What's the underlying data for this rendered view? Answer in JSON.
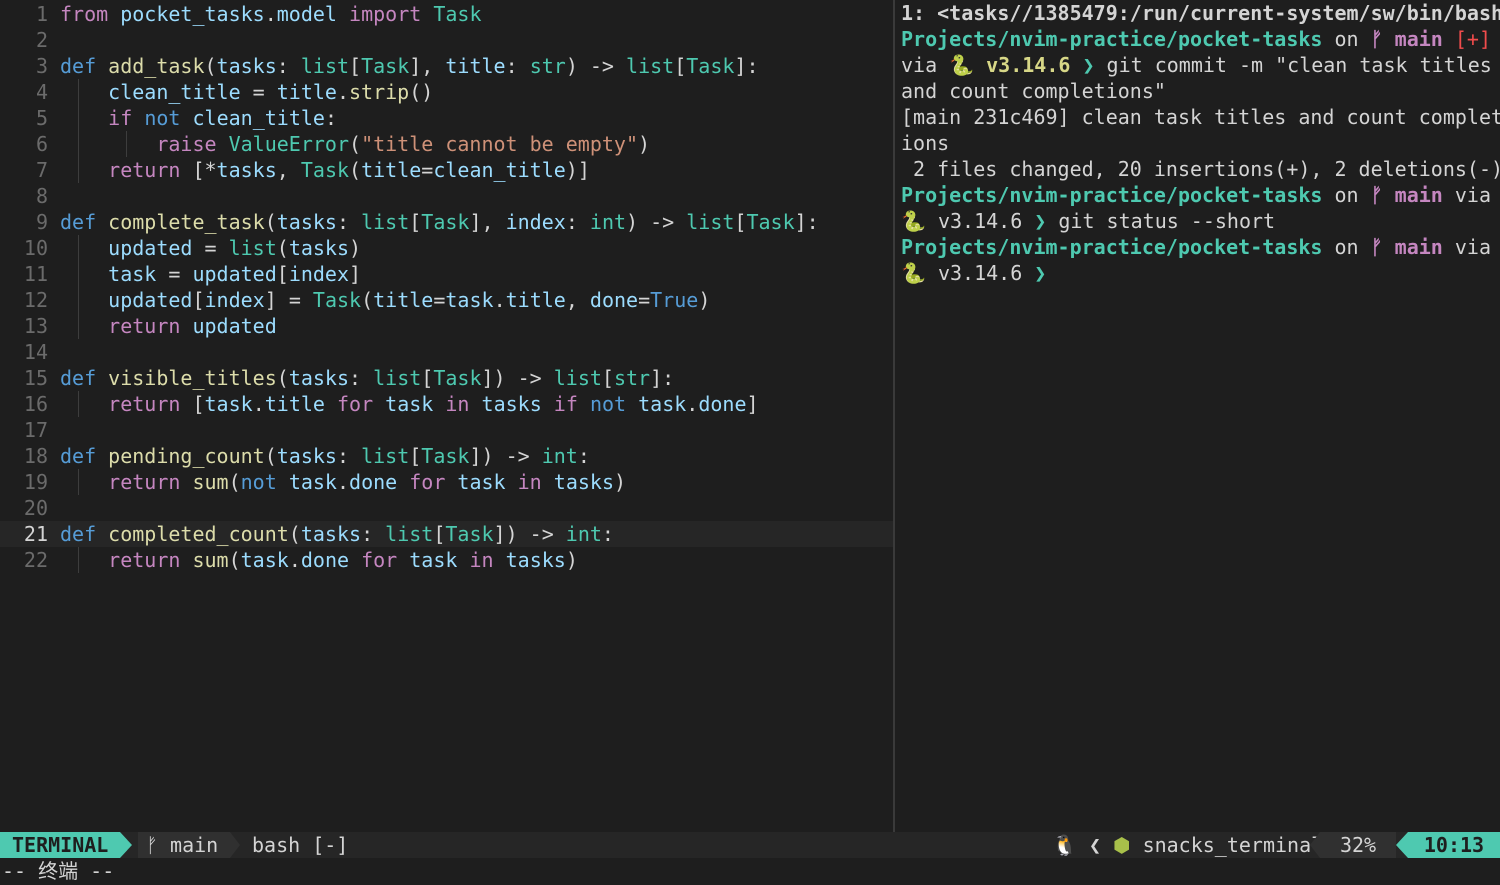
{
  "editor": {
    "lines": [
      {
        "n": "1",
        "tokens": [
          [
            "kw2",
            "from"
          ],
          [
            "pu",
            " "
          ],
          [
            "va",
            "pocket_tasks"
          ],
          [
            "pu",
            "."
          ],
          [
            "va",
            "model"
          ],
          [
            "pu",
            " "
          ],
          [
            "kw2",
            "import"
          ],
          [
            "pu",
            " "
          ],
          [
            "ty",
            "Task"
          ]
        ]
      },
      {
        "n": "2",
        "tokens": []
      },
      {
        "n": "3",
        "tokens": [
          [
            "kw",
            "def"
          ],
          [
            "pu",
            " "
          ],
          [
            "fn",
            "add_task"
          ],
          [
            "pu",
            "("
          ],
          [
            "va",
            "tasks"
          ],
          [
            "pu",
            ": "
          ],
          [
            "ty",
            "list"
          ],
          [
            "pu",
            "["
          ],
          [
            "ty",
            "Task"
          ],
          [
            "pu",
            "], "
          ],
          [
            "va",
            "title"
          ],
          [
            "pu",
            ": "
          ],
          [
            "ty",
            "str"
          ],
          [
            "pu",
            ") -> "
          ],
          [
            "ty",
            "list"
          ],
          [
            "pu",
            "["
          ],
          [
            "ty",
            "Task"
          ],
          [
            "pu",
            "]:"
          ]
        ]
      },
      {
        "n": "4",
        "tokens": [
          [
            "pu",
            "    "
          ],
          [
            "va",
            "clean_title"
          ],
          [
            "pu",
            " = "
          ],
          [
            "va",
            "title"
          ],
          [
            "pu",
            "."
          ],
          [
            "fn",
            "strip"
          ],
          [
            "pu",
            "()"
          ]
        ]
      },
      {
        "n": "5",
        "tokens": [
          [
            "pu",
            "    "
          ],
          [
            "kw2",
            "if"
          ],
          [
            "pu",
            " "
          ],
          [
            "kw",
            "not"
          ],
          [
            "pu",
            " "
          ],
          [
            "va",
            "clean_title"
          ],
          [
            "pu",
            ":"
          ]
        ]
      },
      {
        "n": "6",
        "tokens": [
          [
            "pu",
            "        "
          ],
          [
            "kw2",
            "raise"
          ],
          [
            "pu",
            " "
          ],
          [
            "ty",
            "ValueError"
          ],
          [
            "pu",
            "("
          ],
          [
            "st",
            "\"title cannot be empty\""
          ],
          [
            "pu",
            ")"
          ]
        ]
      },
      {
        "n": "7",
        "tokens": [
          [
            "pu",
            "    "
          ],
          [
            "kw2",
            "return"
          ],
          [
            "pu",
            " [*"
          ],
          [
            "va",
            "tasks"
          ],
          [
            "pu",
            ", "
          ],
          [
            "ty",
            "Task"
          ],
          [
            "pu",
            "("
          ],
          [
            "va",
            "title"
          ],
          [
            "pu",
            "="
          ],
          [
            "va",
            "clean_title"
          ],
          [
            "pu",
            ")]"
          ]
        ]
      },
      {
        "n": "8",
        "tokens": []
      },
      {
        "n": "9",
        "tokens": [
          [
            "kw",
            "def"
          ],
          [
            "pu",
            " "
          ],
          [
            "fn",
            "complete_task"
          ],
          [
            "pu",
            "("
          ],
          [
            "va",
            "tasks"
          ],
          [
            "pu",
            ": "
          ],
          [
            "ty",
            "list"
          ],
          [
            "pu",
            "["
          ],
          [
            "ty",
            "Task"
          ],
          [
            "pu",
            "], "
          ],
          [
            "va",
            "index"
          ],
          [
            "pu",
            ": "
          ],
          [
            "ty",
            "int"
          ],
          [
            "pu",
            ") -> "
          ],
          [
            "ty",
            "list"
          ],
          [
            "pu",
            "["
          ],
          [
            "ty",
            "Task"
          ],
          [
            "pu",
            "]:"
          ]
        ]
      },
      {
        "n": "10",
        "tokens": [
          [
            "pu",
            "    "
          ],
          [
            "va",
            "updated"
          ],
          [
            "pu",
            " = "
          ],
          [
            "ty",
            "list"
          ],
          [
            "pu",
            "("
          ],
          [
            "va",
            "tasks"
          ],
          [
            "pu",
            ")"
          ]
        ]
      },
      {
        "n": "11",
        "tokens": [
          [
            "pu",
            "    "
          ],
          [
            "va",
            "task"
          ],
          [
            "pu",
            " = "
          ],
          [
            "va",
            "updated"
          ],
          [
            "pu",
            "["
          ],
          [
            "va",
            "index"
          ],
          [
            "pu",
            "]"
          ]
        ]
      },
      {
        "n": "12",
        "tokens": [
          [
            "pu",
            "    "
          ],
          [
            "va",
            "updated"
          ],
          [
            "pu",
            "["
          ],
          [
            "va",
            "index"
          ],
          [
            "pu",
            "] = "
          ],
          [
            "ty",
            "Task"
          ],
          [
            "pu",
            "("
          ],
          [
            "va",
            "title"
          ],
          [
            "pu",
            "="
          ],
          [
            "va",
            "task"
          ],
          [
            "pu",
            "."
          ],
          [
            "va",
            "title"
          ],
          [
            "pu",
            ", "
          ],
          [
            "va",
            "done"
          ],
          [
            "pu",
            "="
          ],
          [
            "kw",
            "True"
          ],
          [
            "pu",
            ")"
          ]
        ]
      },
      {
        "n": "13",
        "tokens": [
          [
            "pu",
            "    "
          ],
          [
            "kw2",
            "return"
          ],
          [
            "pu",
            " "
          ],
          [
            "va",
            "updated"
          ]
        ]
      },
      {
        "n": "14",
        "tokens": []
      },
      {
        "n": "15",
        "tokens": [
          [
            "kw",
            "def"
          ],
          [
            "pu",
            " "
          ],
          [
            "fn",
            "visible_titles"
          ],
          [
            "pu",
            "("
          ],
          [
            "va",
            "tasks"
          ],
          [
            "pu",
            ": "
          ],
          [
            "ty",
            "list"
          ],
          [
            "pu",
            "["
          ],
          [
            "ty",
            "Task"
          ],
          [
            "pu",
            "]) -> "
          ],
          [
            "ty",
            "list"
          ],
          [
            "pu",
            "["
          ],
          [
            "ty",
            "str"
          ],
          [
            "pu",
            "]:"
          ]
        ]
      },
      {
        "n": "16",
        "tokens": [
          [
            "pu",
            "    "
          ],
          [
            "kw2",
            "return"
          ],
          [
            "pu",
            " ["
          ],
          [
            "va",
            "task"
          ],
          [
            "pu",
            "."
          ],
          [
            "va",
            "title"
          ],
          [
            "pu",
            " "
          ],
          [
            "kw2",
            "for"
          ],
          [
            "pu",
            " "
          ],
          [
            "va",
            "task"
          ],
          [
            "pu",
            " "
          ],
          [
            "kw2",
            "in"
          ],
          [
            "pu",
            " "
          ],
          [
            "va",
            "tasks"
          ],
          [
            "pu",
            " "
          ],
          [
            "kw2",
            "if"
          ],
          [
            "pu",
            " "
          ],
          [
            "kw",
            "not"
          ],
          [
            "pu",
            " "
          ],
          [
            "va",
            "task"
          ],
          [
            "pu",
            "."
          ],
          [
            "va",
            "done"
          ],
          [
            "pu",
            "]"
          ]
        ]
      },
      {
        "n": "17",
        "tokens": []
      },
      {
        "n": "18",
        "tokens": [
          [
            "kw",
            "def"
          ],
          [
            "pu",
            " "
          ],
          [
            "fn",
            "pending_count"
          ],
          [
            "pu",
            "("
          ],
          [
            "va",
            "tasks"
          ],
          [
            "pu",
            ": "
          ],
          [
            "ty",
            "list"
          ],
          [
            "pu",
            "["
          ],
          [
            "ty",
            "Task"
          ],
          [
            "pu",
            "]) -> "
          ],
          [
            "ty",
            "int"
          ],
          [
            "pu",
            ":"
          ]
        ]
      },
      {
        "n": "19",
        "tokens": [
          [
            "pu",
            "    "
          ],
          [
            "kw2",
            "return"
          ],
          [
            "pu",
            " "
          ],
          [
            "fn",
            "sum"
          ],
          [
            "pu",
            "("
          ],
          [
            "kw",
            "not"
          ],
          [
            "pu",
            " "
          ],
          [
            "va",
            "task"
          ],
          [
            "pu",
            "."
          ],
          [
            "va",
            "done"
          ],
          [
            "pu",
            " "
          ],
          [
            "kw2",
            "for"
          ],
          [
            "pu",
            " "
          ],
          [
            "va",
            "task"
          ],
          [
            "pu",
            " "
          ],
          [
            "kw2",
            "in"
          ],
          [
            "pu",
            " "
          ],
          [
            "va",
            "tasks"
          ],
          [
            "pu",
            ")"
          ]
        ]
      },
      {
        "n": "20",
        "tokens": []
      },
      {
        "n": "21",
        "tokens": [
          [
            "kw",
            "def"
          ],
          [
            "pu",
            " "
          ],
          [
            "fn",
            "completed_count"
          ],
          [
            "pu",
            "("
          ],
          [
            "va",
            "tasks"
          ],
          [
            "pu",
            ": "
          ],
          [
            "ty",
            "list"
          ],
          [
            "pu",
            "["
          ],
          [
            "ty",
            "Task"
          ],
          [
            "pu",
            "]) -> "
          ],
          [
            "ty",
            "int"
          ],
          [
            "pu",
            ":"
          ]
        ],
        "current": true
      },
      {
        "n": "22",
        "tokens": [
          [
            "pu",
            "    "
          ],
          [
            "kw2",
            "return"
          ],
          [
            "pu",
            " "
          ],
          [
            "fn",
            "sum"
          ],
          [
            "pu",
            "("
          ],
          [
            "va",
            "task"
          ],
          [
            "pu",
            "."
          ],
          [
            "va",
            "done"
          ],
          [
            "pu",
            " "
          ],
          [
            "kw2",
            "for"
          ],
          [
            "pu",
            " "
          ],
          [
            "va",
            "task"
          ],
          [
            "pu",
            " "
          ],
          [
            "kw2",
            "in"
          ],
          [
            "pu",
            " "
          ],
          [
            "va",
            "tasks"
          ],
          [
            "pu",
            ")"
          ]
        ]
      }
    ]
  },
  "terminal": {
    "title": "1: <tasks//1385479:/run/current-system/sw/bin/bash",
    "lines": [
      [
        [
          "path",
          "Projects/nvim-practice/pocket-tasks"
        ],
        [
          "pl",
          " on "
        ],
        [
          "branch",
          "ᚠ main"
        ],
        [
          "pl",
          " "
        ],
        [
          "dirty",
          "[+]"
        ]
      ],
      [
        [
          "pl",
          "via "
        ],
        [
          "snake",
          "🐍"
        ],
        [
          "ver",
          " v3.14.6"
        ],
        [
          "arrow",
          " ❯ "
        ],
        [
          "pl",
          "git commit -m \"clean task titles"
        ]
      ],
      [
        [
          "pl",
          "and count completions\""
        ]
      ],
      [
        [
          "pl",
          "[main 231c469] clean task titles and count complet"
        ]
      ],
      [
        [
          "pl",
          "ions"
        ]
      ],
      [
        [
          "pl",
          " 2 files changed, 20 insertions(+), 2 deletions(-)"
        ]
      ],
      [
        [
          "path",
          "Projects/nvim-practice/pocket-tasks"
        ],
        [
          "pl",
          " on "
        ],
        [
          "branch",
          "ᚠ main"
        ],
        [
          "pl",
          " via"
        ]
      ],
      [
        [
          "snake",
          "🐍"
        ],
        [
          "ver-n",
          " v3.14.6"
        ],
        [
          "arrow",
          " ❯ "
        ],
        [
          "pl",
          "git status --short"
        ]
      ],
      [
        [
          "path",
          "Projects/nvim-practice/pocket-tasks"
        ],
        [
          "pl",
          " on "
        ],
        [
          "branch",
          "ᚠ main"
        ],
        [
          "pl",
          " via"
        ]
      ],
      [
        [
          "snake",
          "🐍"
        ],
        [
          "ver-n",
          " v3.14.6"
        ],
        [
          "arrow",
          " ❯"
        ]
      ]
    ]
  },
  "statusline": {
    "mode": "TERMINAL",
    "branch_icon": "ᚠ",
    "branch": "main",
    "file": "bash [-]",
    "os_icon": "🐧",
    "sep": "❮",
    "ft_icon": "⬢",
    "filetype": "snacks_terminal",
    "percent": "32%",
    "time": "10:13"
  },
  "cmdline": {
    "text": "-- 终端 --"
  },
  "colors": {
    "accent": "#4ec9b0",
    "background": "#1e1e1e"
  }
}
